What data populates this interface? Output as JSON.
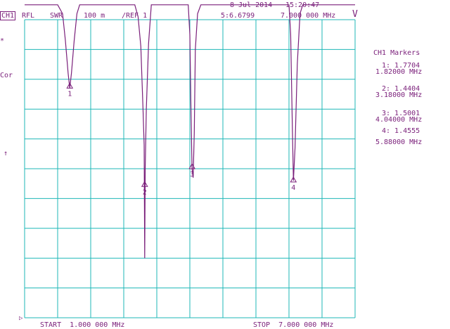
{
  "header": {
    "date": "8 Jul 2014",
    "time": "15:20:47",
    "channel": "CH1",
    "measurement": "RFL",
    "format": "SWR",
    "scale": "100 m",
    "reference": "/REF 1",
    "active_marker_readout": "5:6.6799",
    "active_marker_freq": "7.000 000 MHz",
    "reference_symbol": "V"
  },
  "left_annotations": {
    "asterisk": "*",
    "correction": "Cor",
    "arrow": "↑",
    "reference_pointer": "▷"
  },
  "markers_panel": {
    "title": "CH1 Markers",
    "markers": [
      {
        "line1": "1: 1.7704",
        "line2": "1.82000 MHz"
      },
      {
        "line1": "2: 1.4404",
        "line2": "3.18000 MHz"
      },
      {
        "line1": "3: 1.5001",
        "line2": "4.04000 MHz"
      },
      {
        "line1": "4: 1.4555",
        "line2": "5.88000 MHz"
      }
    ]
  },
  "footer": {
    "start": "START  1.000 000 MHz",
    "stop": "STOP  7.000 000 MHz"
  },
  "trace": {
    "color": "#7a1f7a",
    "grid_color": "#1fb7b7",
    "x_start_mhz": 1.0,
    "x_stop_mhz": 7.0,
    "top_swr": 2.0,
    "scale_per_div": 0.1,
    "divisions": 10,
    "samples": [
      {
        "f": 1.0,
        "swr": 2.05
      },
      {
        "f": 1.6,
        "swr": 2.05
      },
      {
        "f": 1.69,
        "swr": 2.02
      },
      {
        "f": 1.74,
        "swr": 1.93
      },
      {
        "f": 1.79,
        "swr": 1.82
      },
      {
        "f": 1.82,
        "swr": 1.77
      },
      {
        "f": 1.85,
        "swr": 1.82
      },
      {
        "f": 1.9,
        "swr": 1.93
      },
      {
        "f": 1.95,
        "swr": 2.02
      },
      {
        "f": 2.0,
        "swr": 2.05
      },
      {
        "f": 3.0,
        "swr": 2.05
      },
      {
        "f": 3.06,
        "swr": 2.01
      },
      {
        "f": 3.11,
        "swr": 1.91
      },
      {
        "f": 3.15,
        "swr": 1.7
      },
      {
        "f": 3.17,
        "swr": 1.58
      },
      {
        "f": 3.18,
        "swr": 1.2
      },
      {
        "f": 3.19,
        "swr": 1.5
      },
      {
        "f": 3.21,
        "swr": 1.7
      },
      {
        "f": 3.25,
        "swr": 1.92
      },
      {
        "f": 3.3,
        "swr": 2.05
      },
      {
        "f": 3.97,
        "swr": 2.05
      },
      {
        "f": 4.0,
        "swr": 1.95
      },
      {
        "f": 4.02,
        "swr": 1.7
      },
      {
        "f": 4.04,
        "swr": 1.5
      },
      {
        "f": 4.06,
        "swr": 1.47
      },
      {
        "f": 4.08,
        "swr": 1.62
      },
      {
        "f": 4.1,
        "swr": 1.9
      },
      {
        "f": 4.14,
        "swr": 2.02
      },
      {
        "f": 4.2,
        "swr": 2.05
      },
      {
        "f": 5.8,
        "swr": 2.05
      },
      {
        "f": 5.83,
        "swr": 1.95
      },
      {
        "f": 5.86,
        "swr": 1.65
      },
      {
        "f": 5.88,
        "swr": 1.46
      },
      {
        "f": 5.91,
        "swr": 1.57
      },
      {
        "f": 5.95,
        "swr": 1.85
      },
      {
        "f": 6.0,
        "swr": 2.02
      },
      {
        "f": 6.05,
        "swr": 2.05
      },
      {
        "f": 7.0,
        "swr": 2.05
      }
    ],
    "marker_points": [
      {
        "label": "1",
        "f": 1.82,
        "swr": 1.7704
      },
      {
        "label": "2",
        "f": 3.18,
        "swr": 1.4404
      },
      {
        "label": "3",
        "f": 4.04,
        "swr": 1.5001
      },
      {
        "label": "4",
        "f": 5.88,
        "swr": 1.4555
      }
    ]
  }
}
